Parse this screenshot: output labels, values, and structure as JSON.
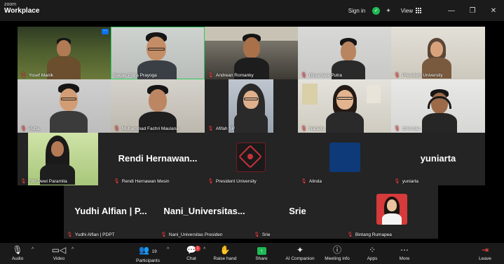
{
  "app": {
    "brand_small": "zoom",
    "brand_large": "Workplace"
  },
  "titlebar": {
    "sign_in": "Sign in",
    "view": "View"
  },
  "participants_row1": [
    "Yosef Manik",
    "Bagas Putra Prayoga",
    "Andrean Romanky",
    "Bimantara Putra",
    "President University"
  ],
  "participants_row2": [
    "Putra",
    "Muhammad Fachri Maulana",
    "Afifah SP",
    "Nadella",
    "Christian"
  ],
  "participants_row3": {
    "t1": "Fitri Dewi Paramita",
    "t2_big": "Rendi  Hernawan...",
    "t2": "Rendi Hernawan Mesin",
    "t3": "President University",
    "t4": "Alinda",
    "t5_big": "yuniarta",
    "t5": "yuniarta"
  },
  "participants_row4": {
    "t1_big": "Yudhi Alfian | P...",
    "t1": "Yudhi Alfian | PDPT",
    "t2_big": "Nani_Universitas...",
    "t2": "Nani_Universitas Presiden",
    "t3_big": "Srie",
    "t3": "Srie",
    "t4": "Bintang Rumapea"
  },
  "toolbar": {
    "audio": "Audio",
    "video": "Video",
    "participants": "Participants",
    "participants_count": "19",
    "chat": "Chat",
    "chat_badge": "1",
    "raise_hand": "Raise hand",
    "share": "Share",
    "ai_companion": "AI Companion",
    "meeting_info": "Meeting info",
    "apps": "Apps",
    "more": "More",
    "leave": "Leave"
  },
  "colors": {
    "active_speaker": "#2ec85b",
    "muted": "#ff4a4a",
    "share": "#1db954",
    "leave": "#ff4a4a"
  }
}
